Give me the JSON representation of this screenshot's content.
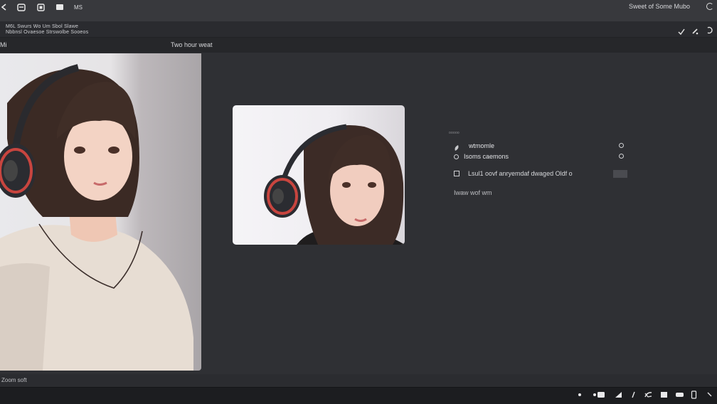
{
  "topbar": {
    "icons": [
      "back-icon",
      "layers-icon",
      "frame-icon",
      "folder-icon"
    ],
    "menu_label": "MS",
    "right_text": "Sweet of Some Mubo"
  },
  "subbar": {
    "left_line1": "M6L Swurs Wo Um Sbol Slawe",
    "left_line2": "Nbbnsl Ovaesoe Strswolbe Sooeos",
    "right_icons": [
      "check-icon",
      "pen-icon",
      "redo-icon"
    ]
  },
  "pathbar": {
    "left_label": "Mi",
    "tab_label": "Two hour weat"
  },
  "options": {
    "heading": "ooooo",
    "items": [
      {
        "label": "wtmomle"
      },
      {
        "label": "Isoms caemons"
      },
      {
        "label": "Lsul1 oovf anryemdaf dwaged Oldf o"
      }
    ],
    "note": "Iwaw wof wm"
  },
  "statusbar": {
    "text": "Zoom soft"
  },
  "taskbar": {
    "icons": [
      "dot-icon",
      "toggle-icon",
      "shape-icon",
      "cursor-icon",
      "puzzle-icon",
      "square-icon",
      "chat-icon",
      "phone-icon",
      "chevron-icon"
    ]
  },
  "colors": {
    "background": "#2f3034",
    "topbar": "#38393d",
    "taskbar": "#1c1d20"
  }
}
